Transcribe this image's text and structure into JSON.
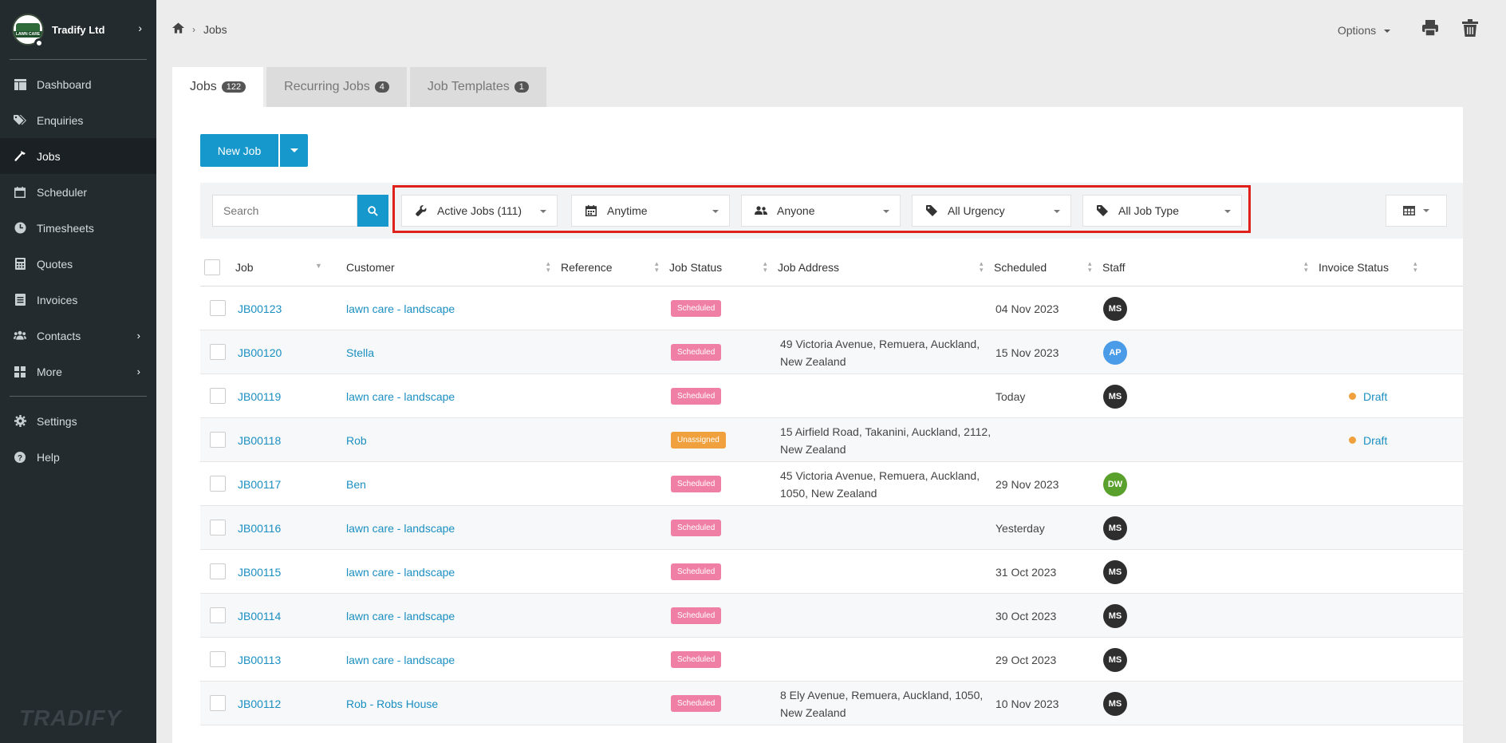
{
  "brand": {
    "name": "Tradify Ltd",
    "logo_text": "LAWN CARE"
  },
  "sidebar": {
    "items": [
      {
        "label": "Dashboard",
        "icon": "dashboard-icon"
      },
      {
        "label": "Enquiries",
        "icon": "tags-icon"
      },
      {
        "label": "Jobs",
        "icon": "hammer-icon",
        "active": true
      },
      {
        "label": "Scheduler",
        "icon": "calendar-icon"
      },
      {
        "label": "Timesheets",
        "icon": "clock-icon"
      },
      {
        "label": "Quotes",
        "icon": "calculator-icon"
      },
      {
        "label": "Invoices",
        "icon": "invoice-icon"
      },
      {
        "label": "Contacts",
        "icon": "users-icon",
        "has_children": true
      },
      {
        "label": "More",
        "icon": "grid-icon",
        "has_children": true
      }
    ],
    "bottom_items": [
      {
        "label": "Settings",
        "icon": "gear-icon"
      },
      {
        "label": "Help",
        "icon": "help-icon"
      }
    ],
    "footer_logo": "TRADIFY"
  },
  "header": {
    "breadcrumb": {
      "current": "Jobs"
    },
    "options_label": "Options"
  },
  "tabs": [
    {
      "label": "Jobs",
      "count": "122",
      "active": true
    },
    {
      "label": "Recurring Jobs",
      "count": "4"
    },
    {
      "label": "Job Templates",
      "count": "1"
    }
  ],
  "toolbar": {
    "new_job_label": "New Job"
  },
  "filters": {
    "search_placeholder": "Search",
    "status": "Active Jobs (111)",
    "date": "Anytime",
    "staff": "Anyone",
    "urgency": "All Urgency",
    "job_type": "All Job Type"
  },
  "table": {
    "columns": {
      "job": "Job",
      "customer": "Customer",
      "reference": "Reference",
      "job_status": "Job Status",
      "job_address": "Job Address",
      "scheduled": "Scheduled",
      "staff": "Staff",
      "invoice_status": "Invoice Status"
    },
    "rows": [
      {
        "job": "JB00123",
        "customer": "lawn care - landscape",
        "status": "Scheduled",
        "address1": "",
        "address2": "",
        "scheduled": "04 Nov 2023",
        "staff": "MS",
        "staff_color": "#2e2e2e",
        "invoice": ""
      },
      {
        "job": "JB00120",
        "customer": "Stella",
        "status": "Scheduled",
        "address1": "49 Victoria Avenue, Remuera, Auckland,",
        "address2": "New Zealand",
        "scheduled": "15 Nov 2023",
        "staff": "AP",
        "staff_color": "#4a9be8",
        "invoice": ""
      },
      {
        "job": "JB00119",
        "customer": "lawn care - landscape",
        "status": "Scheduled",
        "address1": "",
        "address2": "",
        "scheduled": "Today",
        "staff": "MS",
        "staff_color": "#2e2e2e",
        "invoice": "Draft"
      },
      {
        "job": "JB00118",
        "customer": "Rob",
        "status": "Unassigned",
        "address1": "15 Airfield Road, Takanini, Auckland, 2112,",
        "address2": "New Zealand",
        "scheduled": "",
        "staff": "",
        "staff_color": "",
        "invoice": "Draft"
      },
      {
        "job": "JB00117",
        "customer": "Ben",
        "status": "Scheduled",
        "address1": "45 Victoria Avenue, Remuera, Auckland,",
        "address2": "1050, New Zealand",
        "scheduled": "29 Nov 2023",
        "staff": "DW",
        "staff_color": "#5aa02c",
        "invoice": ""
      },
      {
        "job": "JB00116",
        "customer": "lawn care - landscape",
        "status": "Scheduled",
        "address1": "",
        "address2": "",
        "scheduled": "Yesterday",
        "staff": "MS",
        "staff_color": "#2e2e2e",
        "invoice": ""
      },
      {
        "job": "JB00115",
        "customer": "lawn care - landscape",
        "status": "Scheduled",
        "address1": "",
        "address2": "",
        "scheduled": "31 Oct 2023",
        "staff": "MS",
        "staff_color": "#2e2e2e",
        "invoice": ""
      },
      {
        "job": "JB00114",
        "customer": "lawn care - landscape",
        "status": "Scheduled",
        "address1": "",
        "address2": "",
        "scheduled": "30 Oct 2023",
        "staff": "MS",
        "staff_color": "#2e2e2e",
        "invoice": ""
      },
      {
        "job": "JB00113",
        "customer": "lawn care - landscape",
        "status": "Scheduled",
        "address1": "",
        "address2": "",
        "scheduled": "29 Oct 2023",
        "staff": "MS",
        "staff_color": "#2e2e2e",
        "invoice": ""
      },
      {
        "job": "JB00112",
        "customer": "Rob - Robs House",
        "status": "Scheduled",
        "address1": "8 Ely Avenue, Remuera, Auckland, 1050,",
        "address2": "New Zealand",
        "scheduled": "10 Nov 2023",
        "staff": "MS",
        "staff_color": "#2e2e2e",
        "invoice": ""
      }
    ]
  },
  "colors": {
    "accent": "#1798cc",
    "sidebar_bg": "#232b2f",
    "scheduled": "#f07fa6",
    "unassigned": "#f0a03c",
    "highlight": "#e0201b"
  }
}
